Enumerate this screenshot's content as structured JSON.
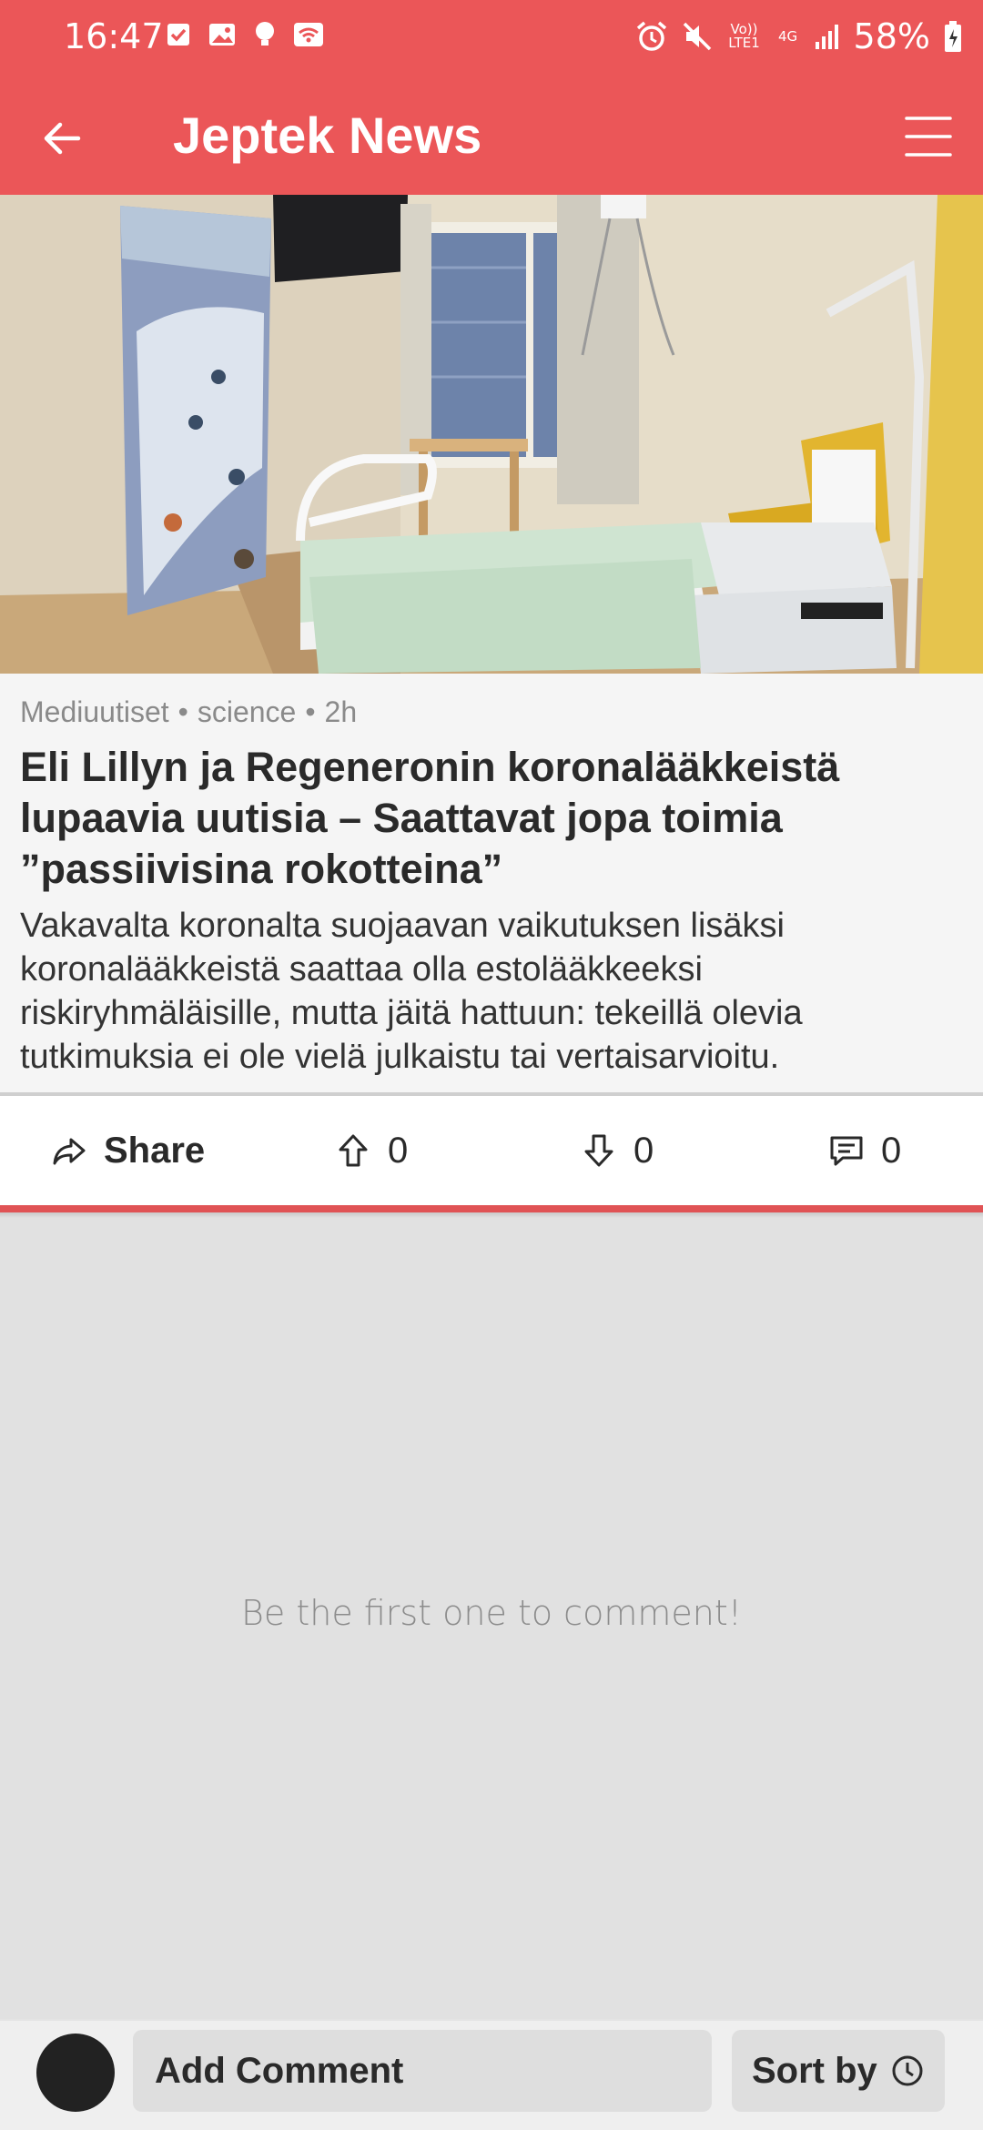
{
  "status_bar": {
    "time": "16:47",
    "battery_pct": "58%",
    "network": "4G",
    "volte": "Vo)) LTE1",
    "icons": [
      "checkbox-icon",
      "gallery-icon",
      "bulb-icon",
      "wifi-icon",
      "alarm-icon",
      "mute-icon",
      "signal-icon",
      "battery-icon"
    ]
  },
  "appbar": {
    "title": "Jeptek News",
    "back_icon": "arrow-left-icon",
    "menu_icon": "hamburger-menu-icon"
  },
  "article": {
    "source": "Mediuutiset",
    "category": "science",
    "age": "2h",
    "separator": "•",
    "headline": "Eli Lillyn ja Regeneronin koronalääkkeistä lupaavia uutisia – Saattavat jopa toimia ”passiivisina rokotteina”",
    "summary": "Vakavalta koronalta suojaavan vaikutuksen lisäksi koronalääkkeistä saattaa olla estolääkkeeksi riskiryhmäläisille, mutta jäitä hattuun: tekeillä olevia tutkimuksia ei ole vielä julkaistu tai vertaisarvioitu."
  },
  "actions": {
    "share_label": "Share",
    "upvotes": "0",
    "downvotes": "0",
    "comments": "0"
  },
  "comments": {
    "empty_message": "Be the first one to comment!"
  },
  "bottom_bar": {
    "add_comment_label": "Add Comment",
    "sort_label": "Sort by"
  },
  "colors": {
    "accent": "#eb5658",
    "divider_red": "#e05355",
    "background": "#e1e1e1"
  }
}
